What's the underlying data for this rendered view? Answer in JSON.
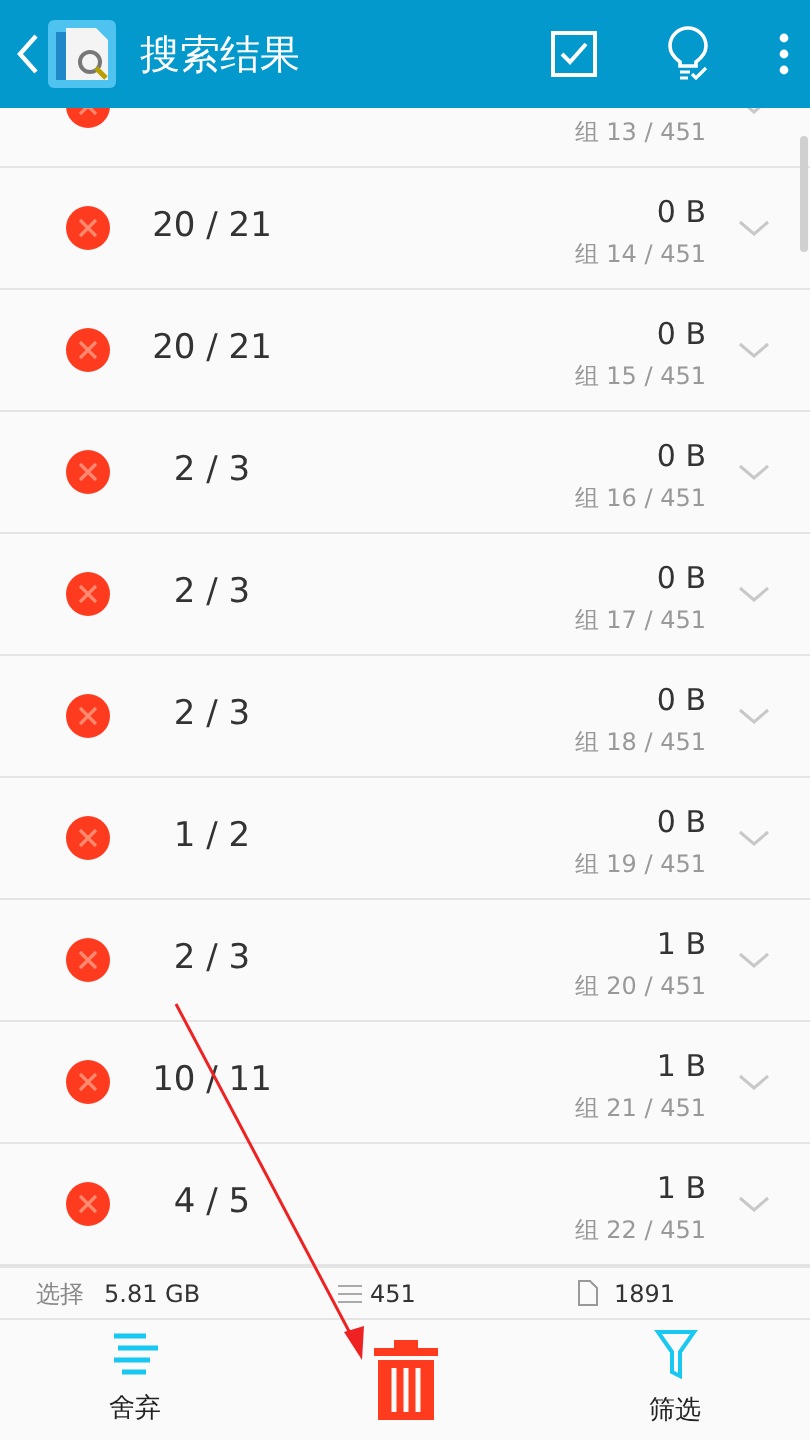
{
  "header": {
    "title": "搜索结果"
  },
  "rows": [
    {
      "group": "组 13 / 451"
    },
    {
      "ratio": "20 / 21",
      "size": "0 B",
      "group": "组 14 / 451"
    },
    {
      "ratio": "20 / 21",
      "size": "0 B",
      "group": "组 15 / 451"
    },
    {
      "ratio": "2 / 3",
      "size": "0 B",
      "group": "组 16 / 451"
    },
    {
      "ratio": "2 / 3",
      "size": "0 B",
      "group": "组 17 / 451"
    },
    {
      "ratio": "2 / 3",
      "size": "0 B",
      "group": "组 18 / 451"
    },
    {
      "ratio": "1 / 2",
      "size": "0 B",
      "group": "组 19 / 451"
    },
    {
      "ratio": "2 / 3",
      "size": "1 B",
      "group": "组 20 / 451"
    },
    {
      "ratio": "10 / 11",
      "size": "1 B",
      "group": "组 21 / 451"
    },
    {
      "ratio": "4 / 5",
      "size": "1 B",
      "group": "组 22 / 451"
    }
  ],
  "stats": {
    "selected_label": "选择",
    "selected_size": "5.81 GB",
    "groups": "451",
    "files": "1891"
  },
  "toolbar": [
    {
      "kind": "discard",
      "label": "舍弃"
    },
    {
      "kind": "delete"
    },
    {
      "kind": "filter",
      "label": "筛选"
    }
  ]
}
